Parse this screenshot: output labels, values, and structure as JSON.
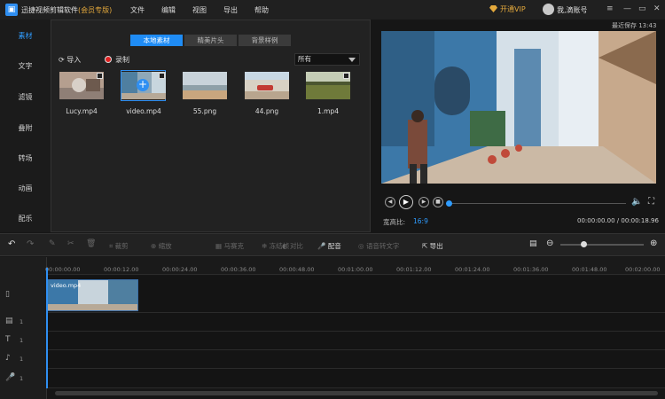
{
  "app": {
    "title": "迅捷视频剪辑软件",
    "edition": "(会员专版)",
    "logo": "film-icon"
  },
  "menu": [
    "文件",
    "编辑",
    "视图",
    "导出",
    "帮助"
  ],
  "account": {
    "vip_label": "开通VIP",
    "user_label": "我,滴账号"
  },
  "sidebar": [
    "素材",
    "文字",
    "滤镜",
    "叠附",
    "转场",
    "动画",
    "配乐"
  ],
  "library": {
    "tabs": [
      "本地素材",
      "精美片头",
      "背景样例"
    ],
    "import_label": "导入",
    "record_label": "录制",
    "filter_value": "所有",
    "items": [
      {
        "label": "Lucy.mp4"
      },
      {
        "label": "video.mp4"
      },
      {
        "label": "55.png"
      },
      {
        "label": "44.png"
      },
      {
        "label": "1.mp4"
      }
    ]
  },
  "preview": {
    "save_status": "最近保存 13:43",
    "aspect_label": "宽高比:",
    "aspect_value": "16:9",
    "timecode": "00:00:00.00 / 00:00:18.96",
    "progress": 0
  },
  "toolbar": {
    "crop": "裁剪",
    "zoom": "缩放",
    "mosaic": "马赛克",
    "freeze": "冻结帧",
    "contrast": "对比",
    "dub": "配音",
    "speech_to_text": "语音转文字",
    "export": "导出"
  },
  "ruler": [
    "00:00:00.00",
    "00:00:12.00",
    "00:00:24.00",
    "00:00:36.00",
    "00:00:48.00",
    "00:01:00.00",
    "00:01:12.00",
    "00:01:24.00",
    "00:01:36.00",
    "00:01:48.00",
    "00:02:00.00"
  ],
  "timeline": {
    "clip_label": "video.mp4",
    "track_count": "1"
  },
  "colors": {
    "accent": "#2f8ff2",
    "vip": "#e4a93c"
  }
}
